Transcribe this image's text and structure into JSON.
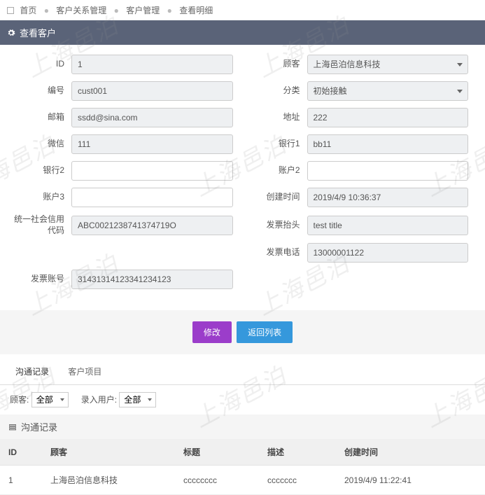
{
  "watermark": "上海邑泊",
  "crumb": {
    "home": "首页",
    "a": "客户关系管理",
    "b": "客户管理",
    "c": "查看明细"
  },
  "panel_title": "查看客户",
  "form": {
    "id": {
      "label": "ID",
      "value": "1"
    },
    "advisor": {
      "label": "顾客",
      "value": "上海邑泊信息科技"
    },
    "code": {
      "label": "编号",
      "value": "cust001"
    },
    "category": {
      "label": "分类",
      "value": "初始接触"
    },
    "email": {
      "label": "邮箱",
      "value": "ssdd@sina.com"
    },
    "address": {
      "label": "地址",
      "value": "222"
    },
    "wechat": {
      "label": "微信",
      "value": "111"
    },
    "bank1": {
      "label": "银行1",
      "value": "bb11"
    },
    "bank2": {
      "label": "银行2",
      "value": ""
    },
    "acct2": {
      "label": "账户2",
      "value": ""
    },
    "acct3": {
      "label": "账户3",
      "value": ""
    },
    "created": {
      "label": "创建时间",
      "value": "2019/4/9 10:36:37"
    },
    "uscc": {
      "label": "统一社会信用代码",
      "value": "ABC0021238741374719O"
    },
    "inv_title": {
      "label": "发票抬头",
      "value": "test title"
    },
    "inv_tel": {
      "label": "发票电话",
      "value": "13000001122"
    },
    "inv_acct": {
      "label": "发票账号",
      "value": "31431314123341234123"
    }
  },
  "buttons": {
    "edit": "修改",
    "back": "返回列表"
  },
  "tabs": {
    "a": "沟通记录",
    "b": "客户项目"
  },
  "filter": {
    "advisor_label": "顾客:",
    "advisor_value": "全部",
    "user_label": "录入用户:",
    "user_value": "全部"
  },
  "section_title": "沟通记录",
  "table": {
    "headers": {
      "id": "ID",
      "advisor": "顾客",
      "title": "标题",
      "desc": "描述",
      "created": "创建时间"
    },
    "rows": [
      {
        "id": "1",
        "advisor": "上海邑泊信息科技",
        "title": "cccccccc",
        "desc": "ccccccc",
        "created": "2019/4/9 11:22:41"
      }
    ]
  }
}
